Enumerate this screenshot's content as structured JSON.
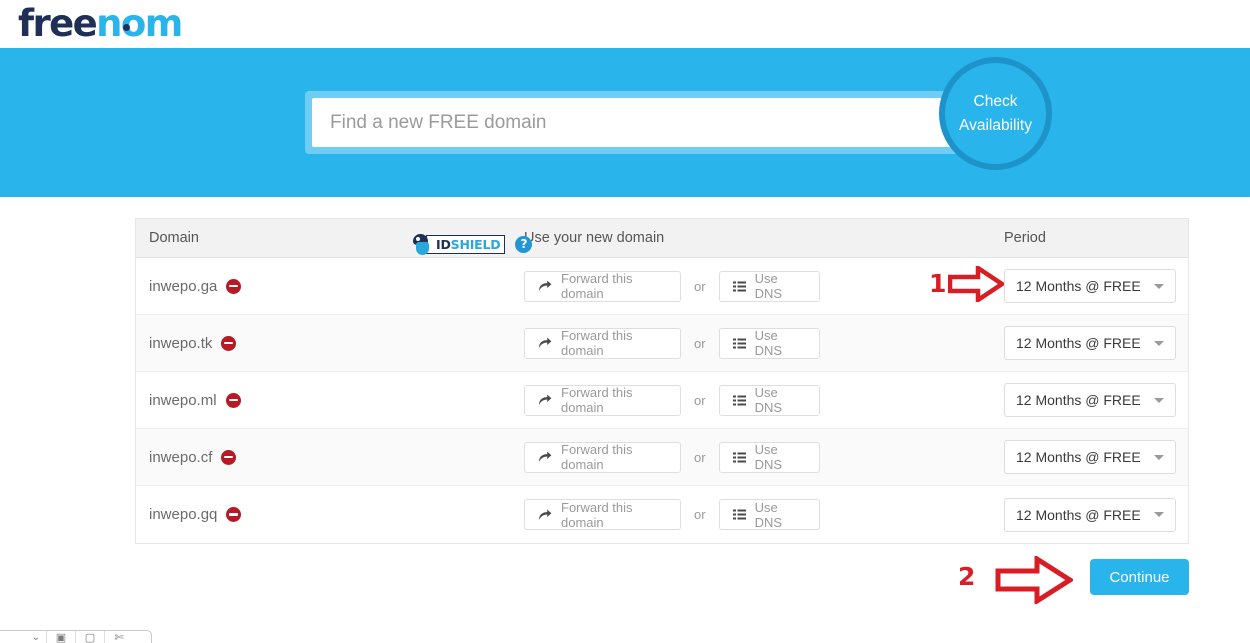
{
  "brand": {
    "logo_first": "free",
    "logo_second": "nom"
  },
  "search": {
    "placeholder": "Find a new FREE domain",
    "value": "",
    "check_button_line1": "Check",
    "check_button_line2": "Availability",
    "banner_color": "#29b4ec"
  },
  "table": {
    "headers": {
      "domain": "Domain",
      "use_domain": "Use your new domain",
      "period": "Period"
    },
    "idshield": {
      "id_text": "ID",
      "shield_text": "SHIELD",
      "help_glyph": "?"
    },
    "or_label": "or",
    "forward_label": "Forward this domain",
    "dns_label": "Use DNS",
    "rows": [
      {
        "domain": "inwepo.ga",
        "forward": "Forward this domain",
        "dns": "Use DNS",
        "period": "12 Months @ FREE"
      },
      {
        "domain": "inwepo.tk",
        "forward": "Forward this domain",
        "dns": "Use DNS",
        "period": "12 Months @ FREE"
      },
      {
        "domain": "inwepo.ml",
        "forward": "Forward this domain",
        "dns": "Use DNS",
        "period": "12 Months @ FREE"
      },
      {
        "domain": "inwepo.cf",
        "forward": "Forward this domain",
        "dns": "Use DNS",
        "period": "12 Months @ FREE"
      },
      {
        "domain": "inwepo.gq",
        "forward": "Forward this domain",
        "dns": "Use DNS",
        "period": "12 Months @ FREE"
      }
    ]
  },
  "annotations": {
    "step1": "1",
    "step2": "2",
    "color": "#d81d25"
  },
  "footer": {
    "continue_label": "Continue"
  }
}
